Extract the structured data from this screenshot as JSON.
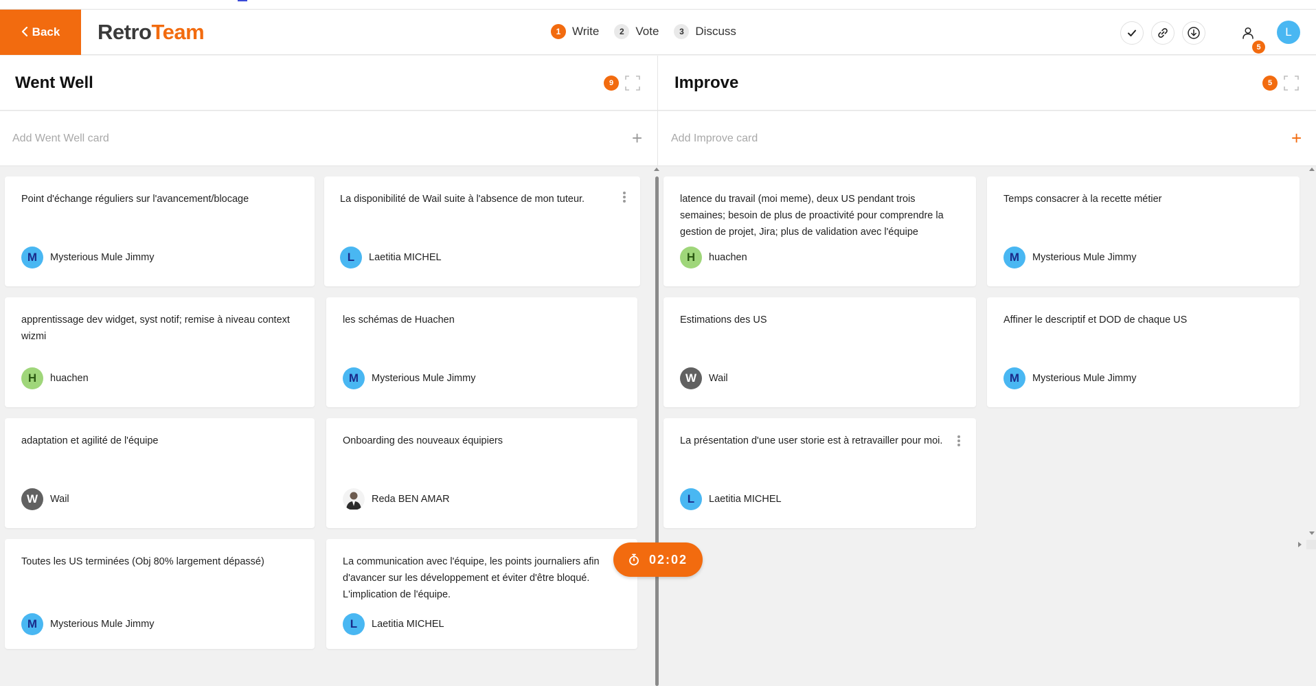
{
  "header": {
    "back_label": "Back",
    "logo_part1": "Retro",
    "logo_part2": "Team",
    "steps": [
      {
        "num": "1",
        "label": "Write"
      },
      {
        "num": "2",
        "label": "Vote"
      },
      {
        "num": "3",
        "label": "Discuss"
      }
    ],
    "participants_count": "5",
    "user_initial": "L"
  },
  "columns": {
    "went_well": {
      "title": "Went Well",
      "count": "9",
      "add_placeholder": "Add Went Well card",
      "cards": [
        {
          "text": "Point d'échange réguliers sur l'avancement/blocage",
          "author": "Mysterious Mule Jimmy",
          "initial": "M"
        },
        {
          "text": "La disponibilité de Wail suite à l'absence de mon tuteur.",
          "author": "Laetitia MICHEL",
          "initial": "L"
        },
        {
          "text": "apprentissage dev widget, syst notif; remise à niveau context wizmi",
          "author": "huachen",
          "initial": "H"
        },
        {
          "text": "les schémas de Huachen",
          "author": "Mysterious Mule Jimmy",
          "initial": "M"
        },
        {
          "text": "adaptation et agilité de l'équipe",
          "author": "Wail",
          "initial": "W"
        },
        {
          "text": "Onboarding des nouveaux équipiers",
          "author": "Reda BEN AMAR",
          "initial": ""
        },
        {
          "text": "Toutes les US terminées (Obj 80% largement dépassé)",
          "author": "Mysterious Mule Jimmy",
          "initial": "M"
        },
        {
          "text": "La communication avec l'équipe, les points journaliers afin d'avancer sur les développement et éviter d'être bloqué. L'implication de l'équipe.",
          "author": "Laetitia MICHEL",
          "initial": "L"
        }
      ]
    },
    "improve": {
      "title": "Improve",
      "count": "5",
      "add_placeholder": "Add Improve card",
      "cards": [
        {
          "text": "latence du travail (moi meme), deux US pendant trois semaines; besoin de plus de proactivité pour comprendre la gestion de projet, Jira;  plus de validation avec l'équipe",
          "author": "huachen",
          "initial": "H"
        },
        {
          "text": "Temps consacrer à la recette métier",
          "author": "Mysterious Mule Jimmy",
          "initial": "M"
        },
        {
          "text": "Estimations des US",
          "author": "Wail",
          "initial": "W"
        },
        {
          "text": "Affiner le descriptif et DOD de chaque US",
          "author": "Mysterious Mule Jimmy",
          "initial": "M"
        },
        {
          "text": "La présentation d'une user storie est à retravailler pour moi.",
          "author": "Laetitia MICHEL",
          "initial": "L"
        }
      ]
    }
  },
  "timer": "02:02",
  "colors": {
    "accent": "#f26b0f",
    "avatar_blue": "#49b7f2",
    "avatar_green": "#9fd67a",
    "avatar_gray": "#616161"
  }
}
